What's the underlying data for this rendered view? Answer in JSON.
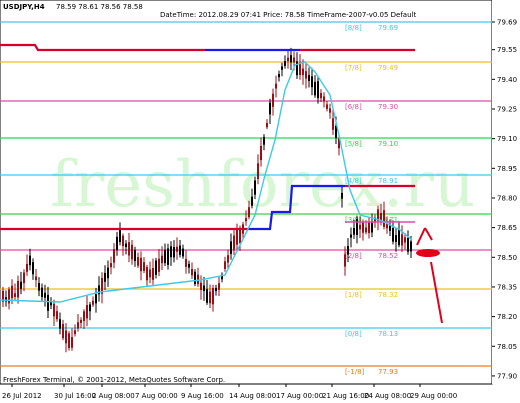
{
  "header": {
    "symbol": "USDJPY,H4",
    "ohlc": "78.59 78.61 78.56 78.58",
    "info": "DateTime: 2012.08.29 07:41   Price: 78.58   TimeFrame-2007-v0.05   Default"
  },
  "watermark": "freshforex.ru",
  "footer": "FreshForex Terminal, © 2001-2012, MetaQuotes Software Corp.",
  "colors": {
    "bg": "#ffffff",
    "bull": "#000000",
    "bear": "#9a0f16",
    "cyan": "#3ec9e8",
    "blue": "#1a1ae6",
    "red": "#d3002e",
    "magenta": "#e04aa6",
    "green": "#2fd84a",
    "yellow": "#e6c21e",
    "orange": "#f07a1a",
    "arrow": "#e0001a"
  },
  "y_ticks": [
    "79.69",
    "79.55",
    "79.40",
    "79.25",
    "79.10",
    "78.95",
    "78.80",
    "78.65",
    "78.50",
    "78.35",
    "78.20",
    "78.05",
    "77.90"
  ],
  "x_ticks": [
    "26 Jul 2012",
    "30 Jul 16:00",
    "2 Aug 08:00",
    "7 Aug 00:00",
    "9 Aug 16:00",
    "14 Aug 08:00",
    "17 Aug 00:00",
    "21 Aug 16:00",
    "24 Aug 08:00",
    "29 Aug 00:00"
  ],
  "murrey_levels": [
    {
      "label": "[8/8]",
      "value": "79.69",
      "tag": "79.69",
      "color": "#3ec9e8"
    },
    {
      "label": "[7/8]",
      "value": "79.49",
      "tag": "79.49",
      "color": "#e6c21e"
    },
    {
      "label": "[6/8]",
      "value": "79.30",
      "tag": "79.30",
      "color": "#e04aa6"
    },
    {
      "label": "[5/8]",
      "value": "79.10",
      "tag": "79.10",
      "color": "#2fd84a"
    },
    {
      "label": "[4/8]",
      "value": "78.91",
      "tag": "78.91",
      "color": "#3ec9e8"
    },
    {
      "label": "[3/8]",
      "value": "78.71",
      "tag": "78.71",
      "color": "#2fd84a"
    },
    {
      "label": "[2/8]",
      "value": "78.52",
      "tag": "78.52",
      "color": "#e04aa6"
    },
    {
      "label": "[1/8]",
      "value": "78.32",
      "tag": "78.32",
      "color": "#e6c21e"
    },
    {
      "label": "[0/8]",
      "value": "78.13",
      "tag": "78.13",
      "color": "#3ec9e8"
    },
    {
      "label": "[-1/8]",
      "value": "77.93",
      "tag": "77.93",
      "color": "#f07a1a"
    }
  ],
  "current_price": "78.58",
  "level_axis_labels": [
    "79.69",
    "79.49",
    "79.30",
    "79.10",
    "78.91",
    "78.71",
    "78.52",
    "78.32",
    "78.13",
    "77.93",
    "78.58",
    "78.54"
  ]
}
